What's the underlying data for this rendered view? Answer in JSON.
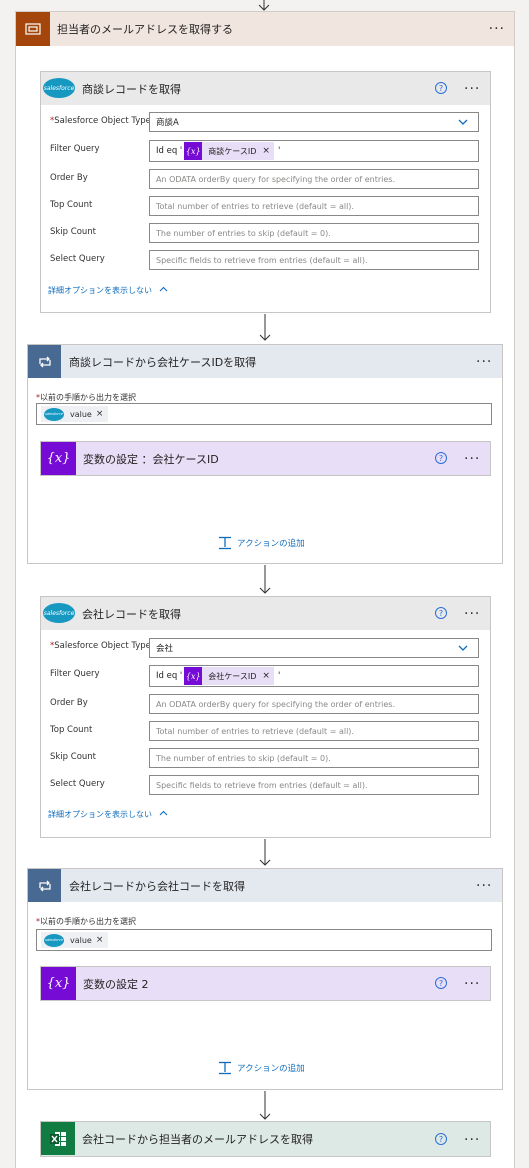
{
  "scope": {
    "title": "担当者のメールアドレスを取得する"
  },
  "deal_get": {
    "title": "商談レコードを取得",
    "help": "?",
    "fields": {
      "object_type": {
        "label": "Salesforce Object Type",
        "value": "商談A"
      },
      "filter": {
        "label": "Filter Query",
        "prefix": "Id eq '",
        "token": "商談ケースID",
        "suffix": "'"
      },
      "order_by": {
        "label": "Order By",
        "placeholder": "An ODATA orderBy query for specifying the order of entries."
      },
      "top_count": {
        "label": "Top Count",
        "placeholder": "Total number of entries to retrieve (default = all)."
      },
      "skip_count": {
        "label": "Skip Count",
        "placeholder": "The number of entries to skip (default = 0)."
      },
      "select_query": {
        "label": "Select Query",
        "placeholder": "Specific fields to retrieve from entries (default = all)."
      }
    },
    "advanced_link": "詳細オプションを表示しない"
  },
  "loop1": {
    "title": "商談レコードから会社ケースIDを取得",
    "select_label": "以前の手順から出力を選択",
    "token": "value",
    "inner": {
      "title": "変数の設定 ：会社ケースID",
      "help": "?"
    },
    "add_action": "アクションの追加"
  },
  "company_get": {
    "title": "会社レコードを取得",
    "help": "?",
    "fields": {
      "object_type": {
        "label": "Salesforce Object Type",
        "value": "会社"
      },
      "filter": {
        "label": "Filter Query",
        "prefix": "Id eq '",
        "token": "会社ケースID",
        "suffix": "'"
      },
      "order_by": {
        "label": "Order By",
        "placeholder": "An ODATA orderBy query for specifying the order of entries."
      },
      "top_count": {
        "label": "Top Count",
        "placeholder": "Total number of entries to retrieve (default = all)."
      },
      "skip_count": {
        "label": "Skip Count",
        "placeholder": "The number of entries to skip (default = 0)."
      },
      "select_query": {
        "label": "Select Query",
        "placeholder": "Specific fields to retrieve from entries (default = all)."
      }
    },
    "advanced_link": "詳細オプションを表示しない"
  },
  "loop2": {
    "title": "会社レコードから会社コードを取得",
    "select_label": "以前の手順から出力を選択",
    "token": "value",
    "inner": {
      "title": "変数の設定 2",
      "help": "?"
    },
    "add_action": "アクションの追加"
  },
  "excel": {
    "title": "会社コードから担当者のメールアドレスを取得",
    "help": "?"
  },
  "common": {
    "required_mark": "*",
    "more": "···",
    "token_remove": "×",
    "var_glyph": "{x}",
    "sf_logo": "salesforce"
  },
  "colors": {
    "scope": "#a4460c",
    "loop": "#486991",
    "variable": "#770bd6",
    "salesforce": "#1798c1",
    "excel": "#107c41",
    "link": "#0f6cbd"
  },
  "icons": [
    "scope-icon",
    "salesforce-icon",
    "loop-icon",
    "variable-icon",
    "excel-icon",
    "help-icon",
    "more-icon",
    "chevron-down-icon",
    "insert-action-icon",
    "flow-arrow-icon"
  ]
}
